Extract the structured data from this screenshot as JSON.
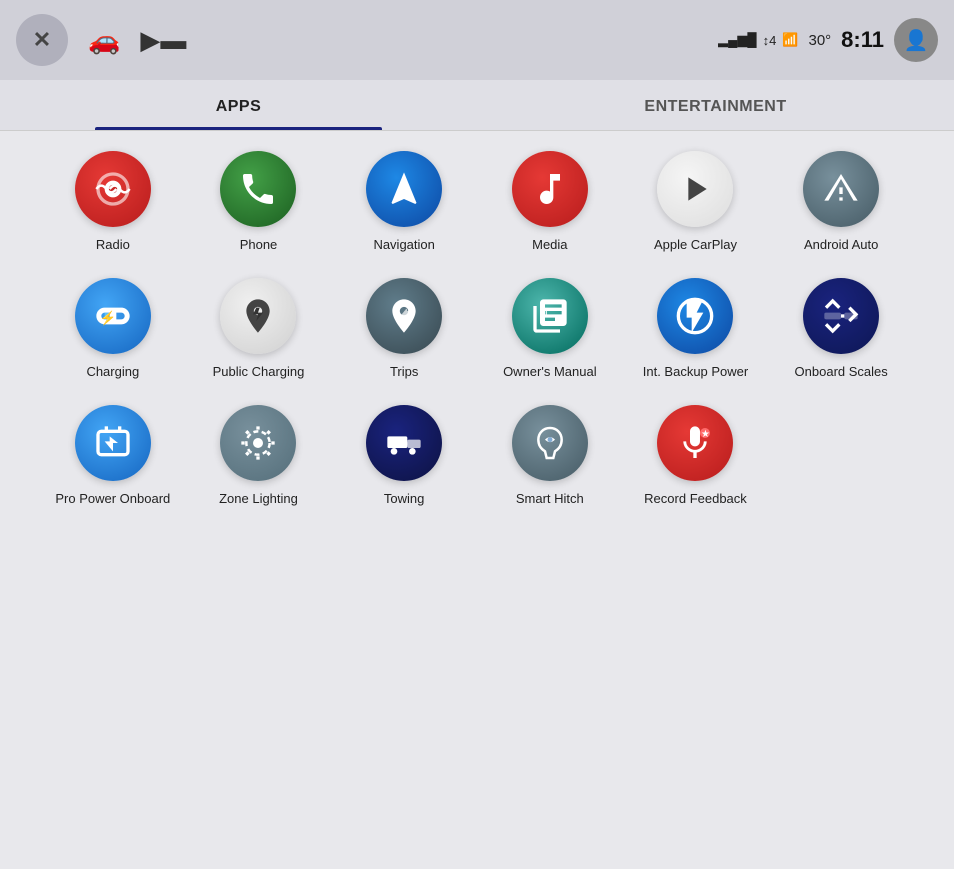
{
  "topbar": {
    "close_label": "✕",
    "time": "8:11",
    "temperature": "30°",
    "signal_bars": "▌▌▌",
    "signal_label": "4↑4",
    "wifi_label": "📶"
  },
  "tabs": [
    {
      "id": "apps",
      "label": "APPS",
      "active": true
    },
    {
      "id": "entertainment",
      "label": "ENTERTAINMENT",
      "active": false
    }
  ],
  "apps": [
    {
      "id": "radio",
      "label": "Radio",
      "bg": "bg-red",
      "icon": "radio"
    },
    {
      "id": "phone",
      "label": "Phone",
      "bg": "bg-green",
      "icon": "phone"
    },
    {
      "id": "navigation",
      "label": "Navigation",
      "bg": "bg-blue-nav",
      "icon": "nav"
    },
    {
      "id": "media",
      "label": "Media",
      "bg": "bg-red-media",
      "icon": "music"
    },
    {
      "id": "apple-carplay",
      "label": "Apple CarPlay",
      "bg": "bg-light-gray",
      "icon": "play"
    },
    {
      "id": "android-auto",
      "label": "Android Auto",
      "bg": "bg-dark-gray",
      "icon": "android"
    },
    {
      "id": "charging",
      "label": "Charging",
      "bg": "bg-blue-light",
      "icon": "charging"
    },
    {
      "id": "public-charging",
      "label": "Public Charging",
      "bg": "bg-white-gray",
      "icon": "pub-charging"
    },
    {
      "id": "trips",
      "label": "Trips",
      "bg": "bg-steel",
      "icon": "trips"
    },
    {
      "id": "owners-manual",
      "label": "Owner's Manual",
      "bg": "bg-teal",
      "icon": "book"
    },
    {
      "id": "int-backup-power",
      "label": "Int. Backup Power",
      "bg": "bg-blue-int",
      "icon": "bolt"
    },
    {
      "id": "onboard-scales",
      "label": "Onboard Scales",
      "bg": "bg-dark-blue",
      "icon": "scales"
    },
    {
      "id": "pro-power-onboard",
      "label": "Pro Power Onboard",
      "bg": "bg-blue-pro",
      "icon": "pro-power"
    },
    {
      "id": "zone-lighting",
      "label": "Zone Lighting",
      "bg": "bg-gray-zone",
      "icon": "zone"
    },
    {
      "id": "towing",
      "label": "Towing",
      "bg": "bg-dark-navy",
      "icon": "towing"
    },
    {
      "id": "smart-hitch",
      "label": "Smart Hitch",
      "bg": "bg-steel-hitch",
      "icon": "hitch"
    },
    {
      "id": "record-feedback",
      "label": "Record Feedback",
      "bg": "bg-red-record",
      "icon": "mic"
    }
  ]
}
